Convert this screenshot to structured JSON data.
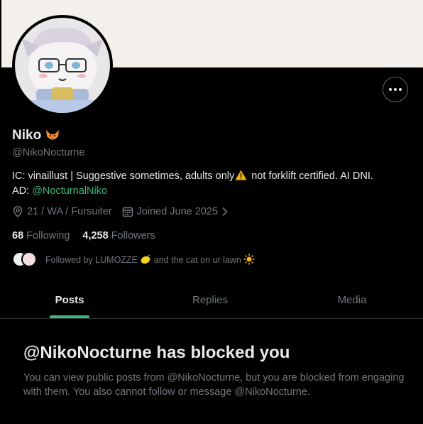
{
  "profile": {
    "name": "Niko",
    "handle": "@NikoNocturne",
    "bio_line1": "IC: vinaillust | Suggestive sometimes, adults only",
    "bio_line1_tail": " not forklift certified. AI DNI.",
    "bio_line2_prefix": "AD: ",
    "bio_mention": "@NocturnalNiko",
    "location": "21 / WA / Fursuiter",
    "joined": "Joined June 2025",
    "following_count": "68",
    "following_label": "Following",
    "followers_count": "4,258",
    "followers_label": "Followers",
    "followed_by_prefix": "Followed by LUMOZZE",
    "followed_by_suffix": " and the cat on ur lawn"
  },
  "tabs": [
    {
      "label": "Posts",
      "active": true
    },
    {
      "label": "Replies",
      "active": false
    },
    {
      "label": "Media",
      "active": false
    }
  ],
  "blocked": {
    "title": "@NikoNocturne has blocked you",
    "body": "You can view public posts from @NikoNocturne, but you are blocked from engaging with them. You also cannot follow or message @NikoNocturne."
  },
  "colors": {
    "background": "#000000",
    "banner": "#f3f0eb",
    "accent": "#3fb67b",
    "muted": "#71767b"
  },
  "icons": [
    "more-icon",
    "fox-emoji-icon",
    "warning-icon",
    "location-icon",
    "calendar-icon",
    "chevron-right-icon",
    "lemon-emoji-icon",
    "sun-emoji-icon"
  ]
}
